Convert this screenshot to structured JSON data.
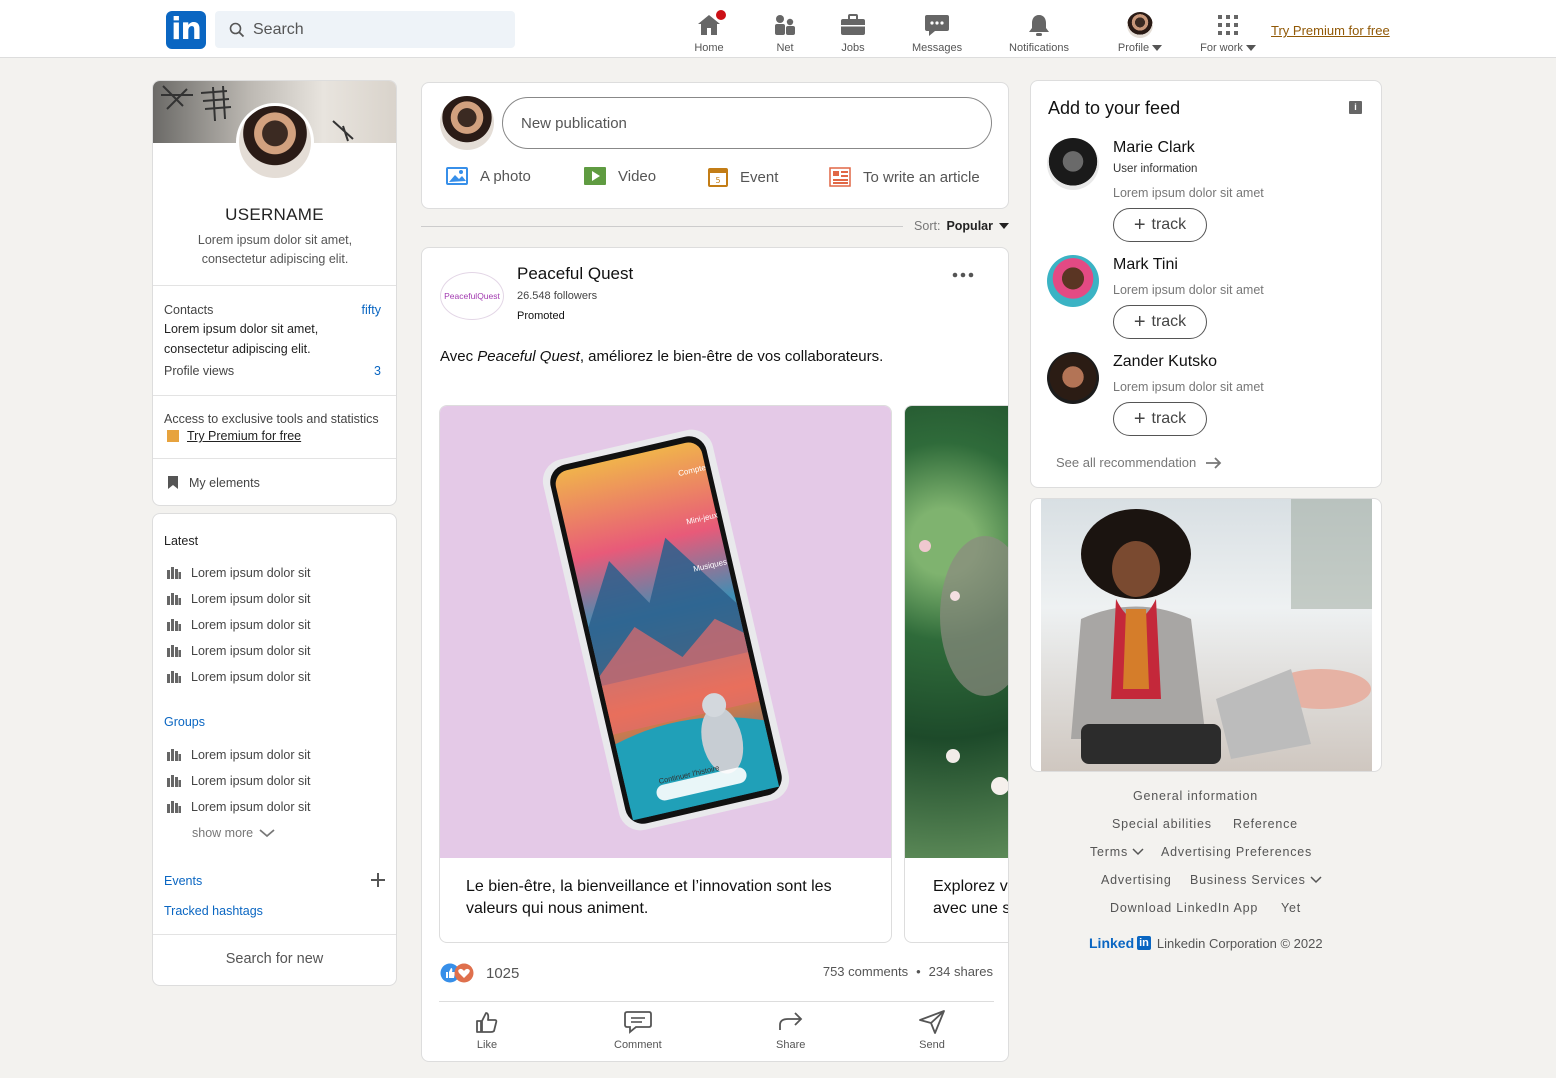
{
  "nav": {
    "logo_text": "in",
    "search_placeholder": "Search",
    "items": [
      {
        "label": "Home"
      },
      {
        "label": "Net"
      },
      {
        "label": "Jobs"
      },
      {
        "label": "Messages"
      },
      {
        "label": "Notifications"
      },
      {
        "label": "Profile"
      },
      {
        "label": "For work"
      }
    ],
    "premium_link": "Try Premium for free"
  },
  "profile": {
    "username": "USERNAME",
    "bio": "Lorem ipsum dolor sit amet, consectetur adipiscing elit.",
    "contacts_label": "Contacts",
    "contacts_value": "fifty",
    "contacts_desc": "Lorem ipsum dolor sit amet, consectetur adipiscing elit.",
    "views_label": "Profile views",
    "views_value": "3",
    "premium_desc": "Access to exclusive tools and statistics",
    "premium_link": "Try Premium for free",
    "my_elements": "My elements"
  },
  "sidebar": {
    "latest_title": "Latest",
    "latest_items": [
      "Lorem ipsum dolor sit",
      "Lorem ipsum dolor sit",
      "Lorem ipsum dolor sit",
      "Lorem ipsum dolor sit",
      "Lorem ipsum dolor sit"
    ],
    "groups_title": "Groups",
    "group_items": [
      "Lorem ipsum dolor sit",
      "Lorem ipsum dolor sit",
      "Lorem ipsum dolor sit"
    ],
    "show_more": "show more",
    "events": "Events",
    "hashtags": "Tracked hashtags",
    "search_new": "Search for new"
  },
  "composer": {
    "placeholder": "New publication",
    "photo": "A photo",
    "video": "Video",
    "event": "Event",
    "article": "To write an article",
    "sort_label": "Sort:",
    "sort_value": "Popular"
  },
  "post": {
    "logo_text": "PeacefulQuest",
    "author": "Peaceful Quest",
    "followers": "26.548 followers",
    "promoted": "Promoted",
    "text_prefix": "Avec ",
    "text_em": "Peaceful Quest",
    "text_suffix": ", améliorez le bien-être de vos collaborateurs.",
    "phone_labels": [
      "Compte",
      "Mini-jeux",
      "Musiques",
      "Continuer l'histoire"
    ],
    "card1_caption": "Le bien-être, la bienveillance et l’innovation sont les valeurs qui nous animent.",
    "card2_caption_l1": "Explorez v",
    "card2_caption_l2": "avec une s",
    "reactions_count": "1025",
    "comments": "753 comments",
    "separator": "•",
    "shares": "234 shares",
    "actions": {
      "like": "Like",
      "comment": "Comment",
      "share": "Share",
      "send": "Send"
    }
  },
  "feed_suggestions": {
    "title": "Add to your feed",
    "people": [
      {
        "name": "Marie Clark",
        "subtitle": "User information",
        "desc": "Lorem ipsum dolor sit amet",
        "button": "track"
      },
      {
        "name": "Mark Tini",
        "desc": "Lorem ipsum dolor sit amet",
        "button": "track"
      },
      {
        "name": "Zander Kutsko",
        "desc": "Lorem ipsum dolor sit amet",
        "button": "track"
      }
    ],
    "see_all": "See all recommendation"
  },
  "footer": {
    "general": "General information",
    "special": "Special abilities",
    "reference": "Reference",
    "terms": "Terms",
    "ad_prefs": "Advertising Preferences",
    "advertising": "Advertising",
    "business": "Business Services",
    "download": "Download LinkedIn App",
    "yet": "Yet",
    "brand_word": "Linked",
    "brand_in": "in",
    "copyright": "Linkedin Corporation © 2022"
  },
  "colors": {
    "brand": "#0a66c2",
    "premium": "#915907",
    "card_bg": "#e4c9e7"
  }
}
